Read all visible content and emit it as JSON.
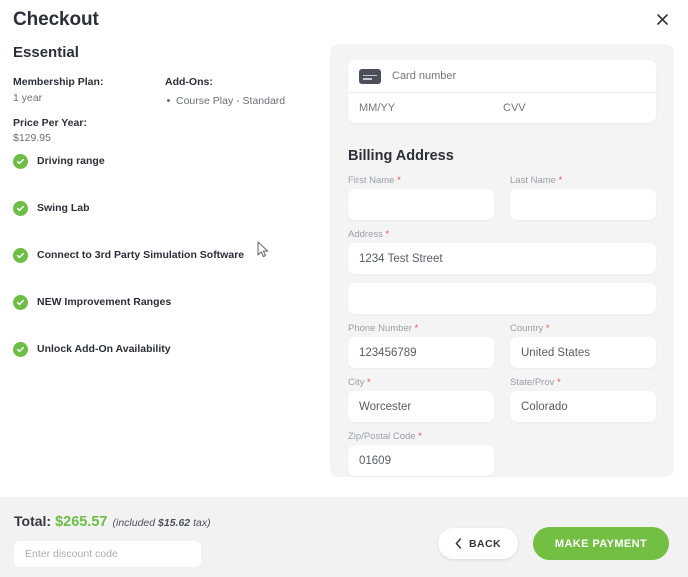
{
  "header": {
    "title": "Checkout",
    "close_icon": "close-icon"
  },
  "summary": {
    "plan_name": "Essential",
    "membership_plan_label": "Membership Plan:",
    "membership_plan_value": "1 year",
    "price_per_year_label": "Price Per Year:",
    "price_per_year_value": "$129.95",
    "addons_label": "Add-Ons:",
    "addons": [
      "Course Play - Standard"
    ],
    "features": [
      "Driving range",
      "Swing Lab",
      "Connect to 3rd Party Simulation Software",
      "NEW Improvement Ranges",
      "Unlock Add-On Availability"
    ]
  },
  "payment": {
    "card_icon": "credit-card-icon",
    "card_number_placeholder": "Card number",
    "card_number_value": "",
    "expiry_placeholder": "MM/YY",
    "expiry_value": "",
    "cvv_placeholder": "CVV",
    "cvv_value": ""
  },
  "billing": {
    "title": "Billing Address",
    "first_name_label": "First Name",
    "first_name_value": "",
    "last_name_label": "Last Name",
    "last_name_value": "",
    "address_label": "Address",
    "address_value": "1234 Test Street",
    "address2_value": "",
    "phone_label": "Phone Number",
    "phone_value": "123456789",
    "country_label": "Country",
    "country_value": "United States",
    "city_label": "City",
    "city_value": "Worcester",
    "state_label": "State/Prov",
    "state_value": "Colorado",
    "zip_label": "Zip/Postal Code",
    "zip_value": "01609",
    "required_marker": "*"
  },
  "footer": {
    "total_label": "Total:",
    "total_amount": "$265.57",
    "tax_prefix": "(included ",
    "tax_amount": "$15.62",
    "tax_suffix": " tax)",
    "discount_placeholder": "Enter discount code",
    "discount_value": "",
    "back_label": "BACK",
    "pay_label": "MAKE PAYMENT"
  },
  "colors": {
    "accent_green": "#6cbe45",
    "button_green": "#72bf44",
    "panel_gray": "#f4f4f4",
    "footer_gray": "#f2f2f2",
    "text_dark": "#2b2f38",
    "label_gray": "#9aa0a8",
    "required_red": "#e2584d"
  }
}
